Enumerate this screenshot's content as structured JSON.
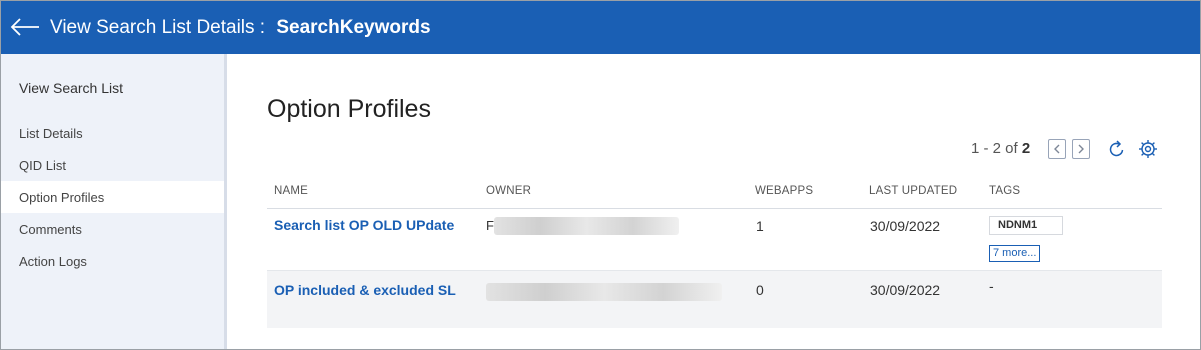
{
  "header": {
    "back_icon": "arrow-left-icon",
    "title_prefix": "View Search List Details :",
    "title_name": "SearchKeywords",
    "bg_color": "#1a5fb4"
  },
  "sidebar": {
    "title": "View Search List",
    "items": [
      {
        "label": "List Details",
        "active": false
      },
      {
        "label": "QID List",
        "active": false
      },
      {
        "label": "Option Profiles",
        "active": true
      },
      {
        "label": "Comments",
        "active": false
      },
      {
        "label": "Action Logs",
        "active": false
      }
    ]
  },
  "main": {
    "title": "Option Profiles",
    "pager": {
      "range": "1 - 2 of",
      "total": "2"
    },
    "icons": [
      "chevron-left-icon",
      "chevron-right-icon",
      "refresh-icon",
      "gear-icon"
    ],
    "columns": [
      "NAME",
      "OWNER",
      "WEBAPPS",
      "LAST UPDATED",
      "TAGS"
    ],
    "rows": [
      {
        "name": "Search list OP OLD UPdate",
        "owner": "F",
        "webapps": "1",
        "last_updated": "30/09/2022",
        "tag": "NDNM1",
        "more": "7 more..."
      },
      {
        "name": "OP included & excluded SL",
        "owner": "",
        "webapps": "0",
        "last_updated": "30/09/2022",
        "tag": "-",
        "more": ""
      }
    ]
  }
}
